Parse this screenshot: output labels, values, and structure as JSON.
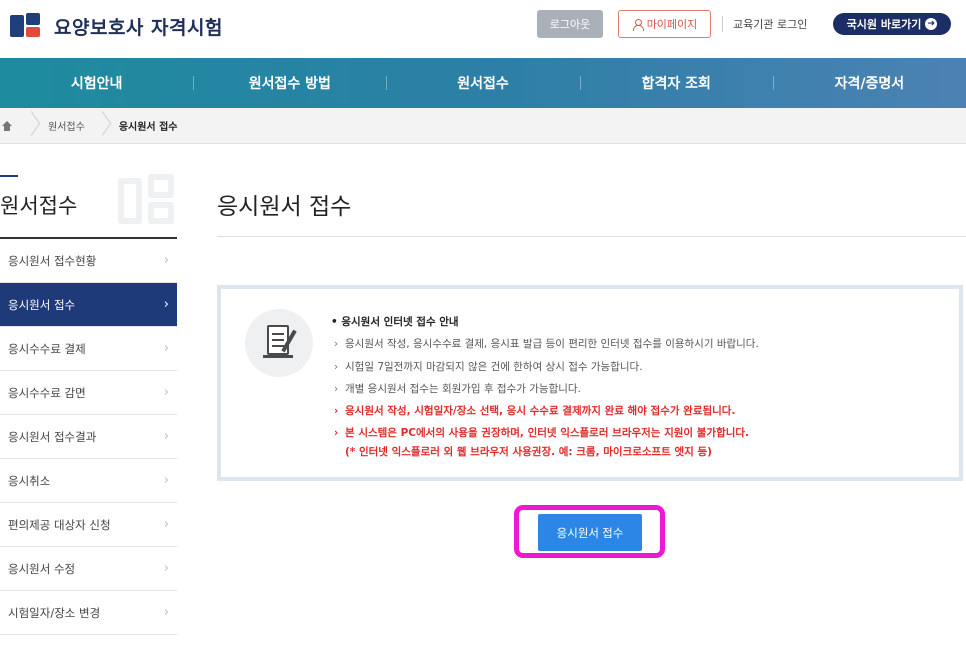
{
  "header": {
    "brand": "요양보호사 자격시험",
    "logout_label": "로그아웃",
    "mypage_label": "마이페이지",
    "institution_login_label": "교육기관 로그인",
    "kuksi_label": "국시원 바로가기"
  },
  "nav": {
    "items": [
      "시험안내",
      "원서접수 방법",
      "원서접수",
      "합격자 조회",
      "자격/증명서"
    ]
  },
  "breadcrumb": {
    "items": [
      "원서접수",
      "응시원서 접수"
    ]
  },
  "sidebar": {
    "title": "원서접수",
    "items": [
      {
        "label": "응시원서 접수현황",
        "active": false
      },
      {
        "label": "응시원서 접수",
        "active": true
      },
      {
        "label": "응시수수료 결제",
        "active": false
      },
      {
        "label": "응시수수료 감면",
        "active": false
      },
      {
        "label": "응시원서 접수결과",
        "active": false
      },
      {
        "label": "응시취소",
        "active": false
      },
      {
        "label": "편의제공 대상자 신청",
        "active": false
      },
      {
        "label": "응시원서 수정",
        "active": false
      },
      {
        "label": "시험일자/장소 변경",
        "active": false
      }
    ]
  },
  "main": {
    "title": "응시원서 접수",
    "guide": {
      "heading": "• 응시원서 인터넷 접수 안내",
      "lines": [
        "응시원서 작성, 응시수수료 결제, 응시표 발급 등이 편리한 인터넷 접수를 이용하시기 바랍니다.",
        "시험일 7일전까지 마감되지 않은 건에 한하여 상시 접수 가능합니다.",
        "개별 응시원서 접수는 회원가입 후 접수가 가능합니다."
      ],
      "warnings": [
        "응시원서 작성, 시험일자/장소 선택, 응시 수수료 결제까지 완료 해야 접수가 완료됩니다.",
        "본 시스템은 PC에서의 사용을 권장하며, 인터넷 익스플로러 브라우저는 지원이 불가합니다."
      ],
      "warning_note": "(* 인터넷 익스플로러 외 웹 브라우저 사용권장. 예: 크롬, 마이크로소프트 엣지 등)"
    },
    "apply_button_label": "응시원서 접수"
  },
  "colors": {
    "nav_gradient_start": "#1d8c9e",
    "nav_gradient_end": "#4b82b3",
    "sidebar_active": "#1f3a78",
    "apply_button": "#2b86e6",
    "highlight": "#ec18d4",
    "warning_text": "#e42b2b"
  }
}
